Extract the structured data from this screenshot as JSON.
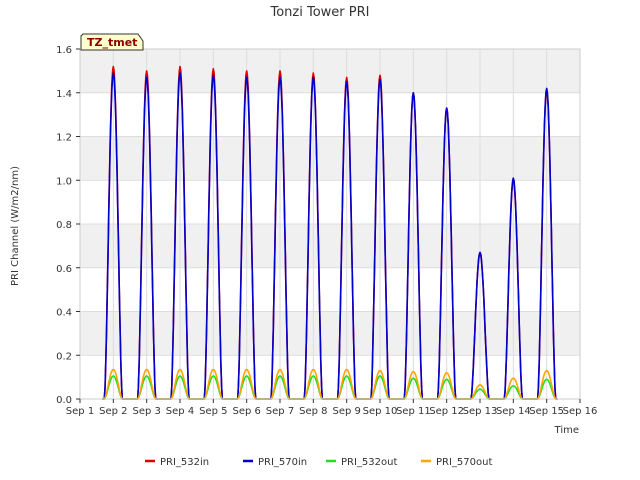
{
  "chart_data": {
    "type": "line",
    "title": "Tonzi Tower PRI",
    "xlabel": "Time",
    "ylabel": "PRI Channel (W/m2/nm)",
    "tag": "TZ_tmet",
    "xlim": [
      1,
      16
    ],
    "ylim": [
      0,
      1.6
    ],
    "x_ticks": [
      "Sep 1",
      "Sep 2",
      "Sep 3",
      "Sep 4",
      "Sep 5",
      "Sep 6",
      "Sep 7",
      "Sep 8",
      "Sep 9",
      "Sep 10",
      "Sep 11",
      "Sep 12",
      "Sep 13",
      "Sep 14",
      "Sep 15",
      "Sep 16"
    ],
    "y_ticks": [
      "0.0",
      "0.2",
      "0.4",
      "0.6",
      "0.8",
      "1.0",
      "1.2",
      "1.4",
      "1.6"
    ],
    "grid": true,
    "legend_position": "bottom",
    "x_note": "day of September; each series peaks near local noon",
    "series": [
      {
        "name": "PRI_532in",
        "color": "#dd0000",
        "x": [
          2,
          3,
          4,
          5,
          6,
          7,
          8,
          9,
          10,
          11,
          12,
          13,
          14,
          15
        ],
        "values": [
          1.52,
          1.5,
          1.52,
          1.51,
          1.5,
          1.5,
          1.49,
          1.47,
          1.48,
          1.4,
          1.33,
          0.67,
          1.0,
          1.41
        ]
      },
      {
        "name": "PRI_570in",
        "color": "#0000cc",
        "x": [
          2,
          3,
          4,
          5,
          6,
          7,
          8,
          9,
          10,
          11,
          12,
          13,
          14,
          15
        ],
        "values": [
          1.49,
          1.47,
          1.49,
          1.48,
          1.47,
          1.47,
          1.47,
          1.45,
          1.46,
          1.4,
          1.33,
          0.67,
          1.01,
          1.42
        ]
      },
      {
        "name": "PRI_532out",
        "color": "#22dd22",
        "x": [
          2,
          3,
          4,
          5,
          6,
          7,
          8,
          9,
          10,
          11,
          12,
          13,
          14,
          15
        ],
        "values": [
          0.105,
          0.105,
          0.105,
          0.105,
          0.105,
          0.105,
          0.105,
          0.105,
          0.105,
          0.095,
          0.09,
          0.045,
          0.06,
          0.09
        ]
      },
      {
        "name": "PRI_570out",
        "color": "#ffa500",
        "x": [
          2,
          3,
          4,
          5,
          6,
          7,
          8,
          9,
          10,
          11,
          12,
          13,
          14,
          15
        ],
        "values": [
          0.135,
          0.135,
          0.135,
          0.135,
          0.135,
          0.135,
          0.135,
          0.135,
          0.13,
          0.125,
          0.12,
          0.065,
          0.095,
          0.13
        ]
      }
    ]
  }
}
